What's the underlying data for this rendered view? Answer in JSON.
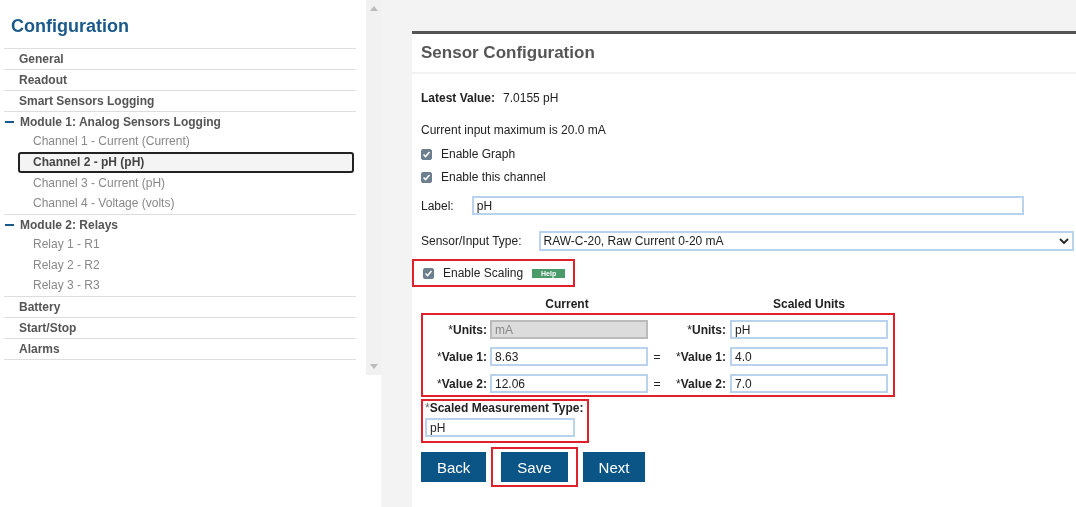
{
  "sidebar": {
    "title": "Configuration",
    "items": [
      {
        "kind": "section",
        "label": "General",
        "selected": false
      },
      {
        "kind": "section",
        "label": "Readout",
        "selected": false
      },
      {
        "kind": "section",
        "label": "Smart Sensors Logging",
        "selected": false
      },
      {
        "kind": "module",
        "label": "Module 1: Analog Sensors Logging",
        "selected": false,
        "expanded": true,
        "children": [
          {
            "label": "Channel 1 - Current (Current)",
            "selected": false
          },
          {
            "label": "Channel 2 - pH (pH)",
            "selected": true
          },
          {
            "label": "Channel 3 - Current (pH)",
            "selected": false
          },
          {
            "label": "Channel 4 - Voltage (volts)",
            "selected": false
          }
        ]
      },
      {
        "kind": "module",
        "label": "Module 2: Relays",
        "selected": false,
        "expanded": true,
        "children": [
          {
            "label": "Relay 1 - R1",
            "selected": false
          },
          {
            "label": "Relay 2 - R2",
            "selected": false
          },
          {
            "label": "Relay 3 - R3",
            "selected": false
          }
        ]
      },
      {
        "kind": "section",
        "label": "Battery",
        "selected": false
      },
      {
        "kind": "section",
        "label": "Start/Stop",
        "selected": false
      },
      {
        "kind": "section",
        "label": "Alarms",
        "selected": false
      }
    ]
  },
  "panel": {
    "title": "Sensor Configuration",
    "latest_value": {
      "label": "Latest Value:",
      "value": "7.0155 pH"
    },
    "info": "Current input maximum is 20.0 mA",
    "checkboxes": [
      {
        "label": "Enable Graph",
        "checked": true
      },
      {
        "label": "Enable this channel",
        "checked": true
      }
    ],
    "label_field": {
      "label": "Label:",
      "value": "pH"
    },
    "sensor_type": {
      "label": "Sensor/Input Type:",
      "value": "RAW-C-20, Raw Current 0-20 mA"
    },
    "enable_scaling": {
      "label": "Enable Scaling",
      "checked": true,
      "help": "Help",
      "highlighted": true
    },
    "scaling": {
      "highlighted": true,
      "headers": [
        "Current",
        "Scaled Units"
      ],
      "rows": [
        {
          "left": {
            "mark": "*",
            "label": "Units:",
            "value": "mA",
            "disabled": true
          },
          "right": {
            "mark": "*",
            "label": "Units:",
            "value": "pH",
            "disabled": false
          }
        },
        {
          "left": {
            "mark": "*",
            "label": "Value 1:",
            "value": "8.63",
            "disabled": false
          },
          "equals": "=",
          "right": {
            "mark": "*",
            "label": "Value 1:",
            "value": "4.0",
            "disabled": false
          }
        },
        {
          "left": {
            "mark": "*",
            "label": "Value 2:",
            "value": "12.06",
            "disabled": false
          },
          "equals": "=",
          "right": {
            "mark": "*",
            "label": "Value 2:",
            "value": "7.0",
            "disabled": false
          }
        }
      ]
    },
    "measurement_type": {
      "mark": "*",
      "label": "Scaled Measurement Type:",
      "value": "pH",
      "highlighted": true
    },
    "buttons": [
      {
        "label": "Back",
        "highlighted": false
      },
      {
        "label": "Save",
        "highlighted": true
      },
      {
        "label": "Next",
        "highlighted": false
      }
    ]
  }
}
